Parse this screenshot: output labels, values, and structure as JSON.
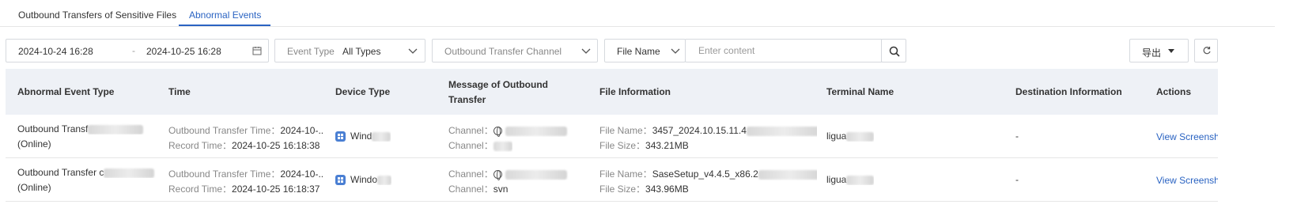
{
  "tabs": [
    {
      "label": "Outbound Transfers of Sensitive Files",
      "active": false
    },
    {
      "label": "Abnormal Events",
      "active": true
    }
  ],
  "accent_color": "#2a63c2",
  "filters": {
    "date_start": "2024-10-24 16:28",
    "date_separator": "-",
    "date_end": "2024-10-25 16:28",
    "event_type_label": "Event Type",
    "event_type_value": "All Types",
    "channel_placeholder": "Outbound Transfer Channel",
    "file_field_value": "File Name",
    "content_placeholder": "Enter content",
    "export_label": "导出",
    "icons": [
      "calendar-icon",
      "chevron-down-icon",
      "search-icon",
      "refresh-icon"
    ]
  },
  "table": {
    "headers": {
      "event_type": "Abnormal Event Type",
      "time": "Time",
      "device_type": "Device Type",
      "message_line1": "Message of Outbound",
      "message_line2": "Transfer",
      "file_info": "File Information",
      "terminal": "Terminal Name",
      "destination": "Destination Information",
      "actions": "Actions"
    },
    "rows": [
      {
        "event_type_line1": "Outbound Transf",
        "event_type_line2": "(Online)",
        "transfer_time_label": "Outbound Transfer Time：",
        "transfer_time_value": "2024-10-...",
        "record_time_label": "Record Time：",
        "record_time_value": "2024-10-25 16:18:38",
        "device_type": "Wind",
        "channel_label_1": "Channel：",
        "channel_label_2": "Channel：",
        "channel_value_2": "",
        "file_name_label": "File Name：",
        "file_name_value": "3457_2024.10.15.11.4",
        "file_size_label": "File Size：",
        "file_size_value": "343.21MB",
        "terminal": "ligua",
        "destination": "-",
        "action": "View Screenshot"
      },
      {
        "event_type_line1": "Outbound Transfer c",
        "event_type_line2": "(Online)",
        "transfer_time_label": "Outbound Transfer Time：",
        "transfer_time_value": "2024-10-...",
        "record_time_label": "Record Time：",
        "record_time_value": "2024-10-25 16:18:37",
        "device_type": "Windo",
        "channel_label_1": "Channel：",
        "channel_label_2": "Channel：",
        "channel_value_2": "svn",
        "file_name_label": "File Name：",
        "file_name_value": "SaseSetup_v4.4.5_x86.2",
        "file_size_label": "File Size：",
        "file_size_value": "343.96MB",
        "terminal": "ligua",
        "destination": "-",
        "action": "View Screenshot"
      }
    ]
  }
}
